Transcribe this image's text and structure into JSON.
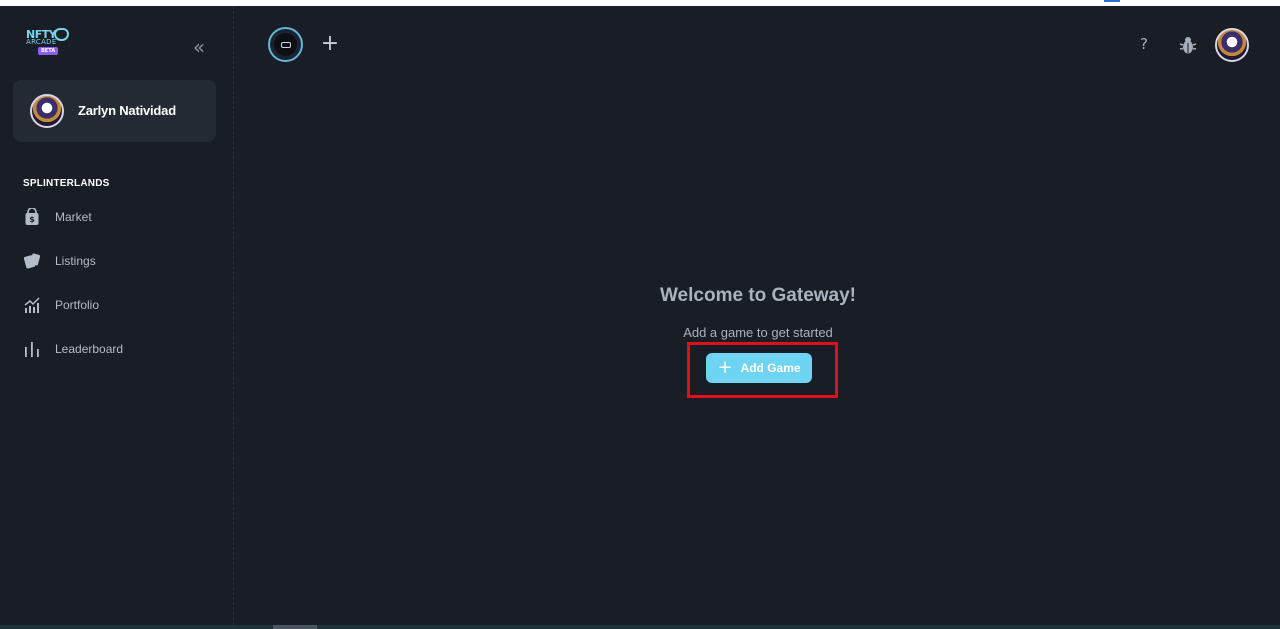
{
  "sidebar": {
    "logo": {
      "line1": "NFTY",
      "line2": "ARCADE",
      "badge": "BETA"
    },
    "user": {
      "name": "Zarlyn Natividad"
    },
    "section_title": "SPLINTERLANDS",
    "items": [
      {
        "label": "Market",
        "icon": "shopping-bag-icon"
      },
      {
        "label": "Listings",
        "icon": "cards-icon"
      },
      {
        "label": "Portfolio",
        "icon": "chart-icon"
      },
      {
        "label": "Leaderboard",
        "icon": "bars-icon"
      }
    ]
  },
  "main": {
    "title": "Welcome to Gateway!",
    "subtitle": "Add a game to get started",
    "add_game_label": "Add Game"
  },
  "topbar": {
    "help_label": "?"
  },
  "colors": {
    "background": "#181d26",
    "card": "#232a34",
    "accent": "#6fd3f2",
    "highlight": "#e0101a"
  }
}
